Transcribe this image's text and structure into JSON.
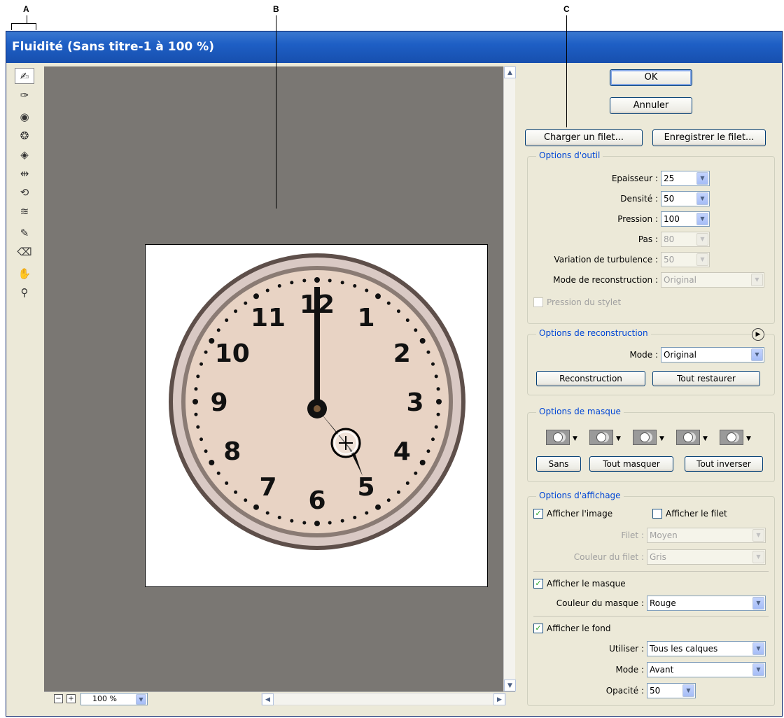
{
  "callouts": {
    "a": "A",
    "b": "B",
    "c": "C"
  },
  "window": {
    "title": "Fluidité (Sans titre-1 à 100 %)"
  },
  "toolbox": {
    "tools": [
      "warp-icon",
      "reconstruct-icon",
      "twirl-icon",
      "pucker-icon",
      "bloat-icon",
      "push-left-icon",
      "mirror-icon",
      "turbulence-icon",
      "freeze-mask-icon",
      "thaw-mask-icon",
      "hand-icon",
      "zoom-icon"
    ]
  },
  "canvas": {
    "zoom_value": "100 %",
    "zoom_out_label": "−",
    "zoom_in_label": "+",
    "clock_numbers": [
      "12",
      "1",
      "2",
      "3",
      "4",
      "5",
      "6",
      "7",
      "8",
      "9",
      "10",
      "11"
    ]
  },
  "buttons": {
    "ok": "OK",
    "cancel": "Annuler",
    "load_mesh": "Charger un filet...",
    "save_mesh": "Enregistrer le filet..."
  },
  "tool_options": {
    "title": "Options d'outil",
    "brush_size_label": "Epaisseur :",
    "brush_size_value": "25",
    "density_label": "Densité :",
    "density_value": "50",
    "pressure_label": "Pression :",
    "pressure_value": "100",
    "rate_label": "Pas :",
    "rate_value": "80",
    "turbulent_jitter_label": "Variation de turbulence :",
    "turbulent_jitter_value": "50",
    "reconstruct_mode_label": "Mode de reconstruction :",
    "reconstruct_mode_value": "Original",
    "stylus_pressure_label": "Pression du stylet"
  },
  "reconstruct_options": {
    "title": "Options de reconstruction",
    "mode_label": "Mode :",
    "mode_value": "Original",
    "reconstruct_button": "Reconstruction",
    "restore_all_button": "Tout restaurer"
  },
  "mask_options": {
    "title": "Options de masque",
    "none_button": "Sans",
    "mask_all_button": "Tout masquer",
    "invert_all_button": "Tout inverser"
  },
  "view_options": {
    "title": "Options d'affichage",
    "show_image_label": "Afficher l'image",
    "show_mesh_label": "Afficher le filet",
    "mesh_size_label": "Filet :",
    "mesh_size_value": "Moyen",
    "mesh_color_label": "Couleur du filet :",
    "mesh_color_value": "Gris",
    "show_mask_label": "Afficher le masque",
    "mask_color_label": "Couleur du masque :",
    "mask_color_value": "Rouge",
    "show_backdrop_label": "Afficher le fond",
    "use_label": "Utiliser :",
    "use_value": "Tous les calques",
    "mode_label": "Mode :",
    "mode_value": "Avant",
    "opacity_label": "Opacité :",
    "opacity_value": "50",
    "check_mark": "✓"
  },
  "colors": {
    "title_bar": "#1e5fc5",
    "group_label": "#0046d5",
    "canvas_bg": "#7a7773"
  }
}
